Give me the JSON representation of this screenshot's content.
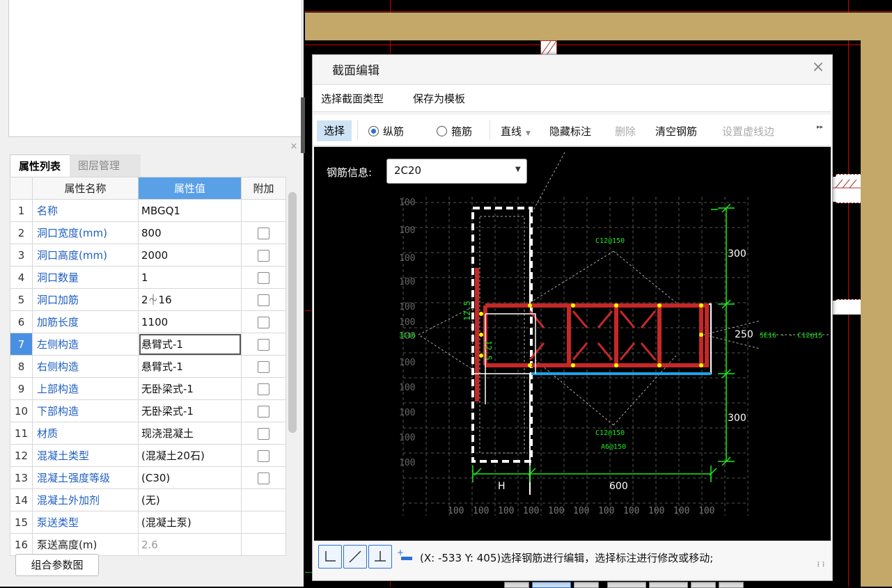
{
  "left_panel": {
    "tabs": [
      "属性列表",
      "图层管理"
    ],
    "columns": [
      "属性名称",
      "属性值",
      "附加"
    ],
    "rows": [
      {
        "no": "1",
        "name": "名称",
        "value": "MBGQ1",
        "check": false
      },
      {
        "no": "2",
        "name": "洞口宽度(mm)",
        "value": "800",
        "check": true
      },
      {
        "no": "3",
        "name": "洞口高度(mm)",
        "value": "2000",
        "check": true
      },
      {
        "no": "4",
        "name": "洞口数量",
        "value": "1",
        "check": true
      },
      {
        "no": "5",
        "name": "洞口加筋",
        "value": "2⏆16",
        "check": true
      },
      {
        "no": "6",
        "name": "加筋长度",
        "value": "1100",
        "check": true
      },
      {
        "no": "7",
        "name": "左侧构造",
        "value": "悬臂式-1",
        "check": true
      },
      {
        "no": "8",
        "name": "右侧构造",
        "value": "悬臂式-1",
        "check": true
      },
      {
        "no": "9",
        "name": "上部构造",
        "value": "无卧梁式-1",
        "check": true
      },
      {
        "no": "10",
        "name": "下部构造",
        "value": "无卧梁式-1",
        "check": true
      },
      {
        "no": "11",
        "name": "材质",
        "value": "现浇混凝土",
        "check": true
      },
      {
        "no": "12",
        "name": "混凝土类型",
        "value": "(混凝土20石)",
        "check": true
      },
      {
        "no": "13",
        "name": "混凝土强度等级",
        "value": "(C30)",
        "check": true
      },
      {
        "no": "14",
        "name": "混凝土外加剂",
        "value": "(无)",
        "check": false
      },
      {
        "no": "15",
        "name": "泵送类型",
        "value": "(混凝土泵)",
        "check": false
      },
      {
        "no": "16",
        "name": "泵送高度(m)",
        "value": "2.6",
        "check": false
      }
    ],
    "combo_button": "组合参数图",
    "close_glyph": "×"
  },
  "dialog": {
    "title": "截面编辑",
    "close_glyph": "×",
    "menu": [
      "选择截面类型",
      "保存为模板"
    ],
    "toolbar": {
      "select": "选择",
      "longitudinal": "纵筋",
      "stirrup": "箍筋",
      "line": "直线",
      "hide_label": "隐藏标注",
      "delete": "删除",
      "clear": "清空钢筋",
      "set_dashed": "设置虚线边",
      "more": "▸▸"
    },
    "rebar_info_label": "钢筋信息:",
    "rebar_info_value": "2C20",
    "drawing": {
      "left_ticks": [
        "100",
        "100",
        "100",
        "100",
        "100",
        "100",
        "100",
        "100",
        "100",
        "100",
        "100",
        "100"
      ],
      "bottom_ticks": [
        "100",
        "100",
        "100",
        "100",
        "100",
        "100",
        "100",
        "100",
        "100",
        "100",
        "100"
      ],
      "dim_300_top": "300",
      "dim_250": "250",
      "dim_300_bottom": "300",
      "dim_600": "600",
      "dim_h": "H",
      "label_c12_top": "C12@150",
      "label_c12_bottom": "C12@150",
      "label_a6": "A6@150",
      "label_3c16": "3C16",
      "label_right": "5E16 - - C12@15",
      "label_vert1": "12.5",
      "label_vert2": "12.5"
    },
    "status_text": "(X: -533 Y: 405)选择钢筋进行编辑，选择标注进行修改或移动;"
  }
}
